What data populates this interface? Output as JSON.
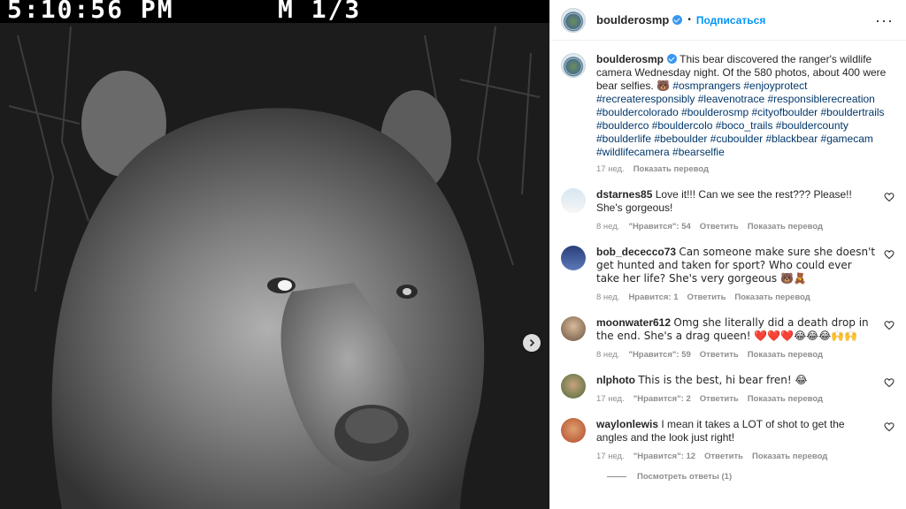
{
  "photo": {
    "timestamp": "5:10:56 PM",
    "frame": "M 1/3",
    "next_icon": "chevron-right-icon"
  },
  "header": {
    "username": "boulderosmp",
    "follow_label": "Подписаться",
    "more_icon": "more-horizontal-icon"
  },
  "caption": {
    "username": "boulderosmp",
    "text": "This bear discovered the ranger's wildlife camera Wednesday night. Of the 580 photos, about 400 were bear selfies. 🐻 ",
    "hashtags": "#osmprangers #enjoyprotect #recreateresponsibly #leavenotrace #responsiblerecreation #bouldercolorado #boulderosmp #cityofboulder #bouldertrails #boulderco #bouldercolo #boco_trails #bouldercounty #boulderlife #beboulder #cuboulder #blackbear #gamecam #wildlifecamera #bearselfie",
    "time": "17 нед.",
    "translate_label": "Показать перевод"
  },
  "comments": [
    {
      "username": "dstarnes85",
      "text": "Love it!!! Can we see the rest??? Please!! She's gorgeous!",
      "time": "8 нед.",
      "likes": "\"Нравится\": 54",
      "reply_label": "Ответить",
      "translate_label": "Показать перевод"
    },
    {
      "username": "bob_dececco73",
      "text": "Can someone make sure she doesn't get hunted and taken for sport? Who could ever take her life? She's very gorgeous 🐻🧸",
      "time": "8 нед.",
      "likes": "Нравится: 1",
      "reply_label": "Ответить",
      "translate_label": "Показать перевод"
    },
    {
      "username": "moonwater612",
      "text": "Omg she literally did a death drop in the end. She's a drag queen! ❤️❤️❤️😂😂😂🙌🙌",
      "time": "8 нед.",
      "likes": "\"Нравится\": 59",
      "reply_label": "Ответить",
      "translate_label": "Показать перевод"
    },
    {
      "username": "nlphoto",
      "text": "This is the best, hi bear fren! 😂",
      "time": "17 нед.",
      "likes": "\"Нравится\": 2",
      "reply_label": "Ответить",
      "translate_label": "Показать перевод"
    },
    {
      "username": "waylonlewis",
      "text": "I mean it takes a LOT of shot to get the angles and the look just right!",
      "time": "17 нед.",
      "likes": "\"Нравится\": 12",
      "reply_label": "Ответить",
      "translate_label": "Показать перевод"
    }
  ],
  "replies": {
    "label": "Посмотреть ответы (1)"
  },
  "colors": {
    "accent": "#0095f6",
    "hashtag": "#00376b",
    "muted": "#8e8e8e",
    "verified": "#3897f0"
  }
}
